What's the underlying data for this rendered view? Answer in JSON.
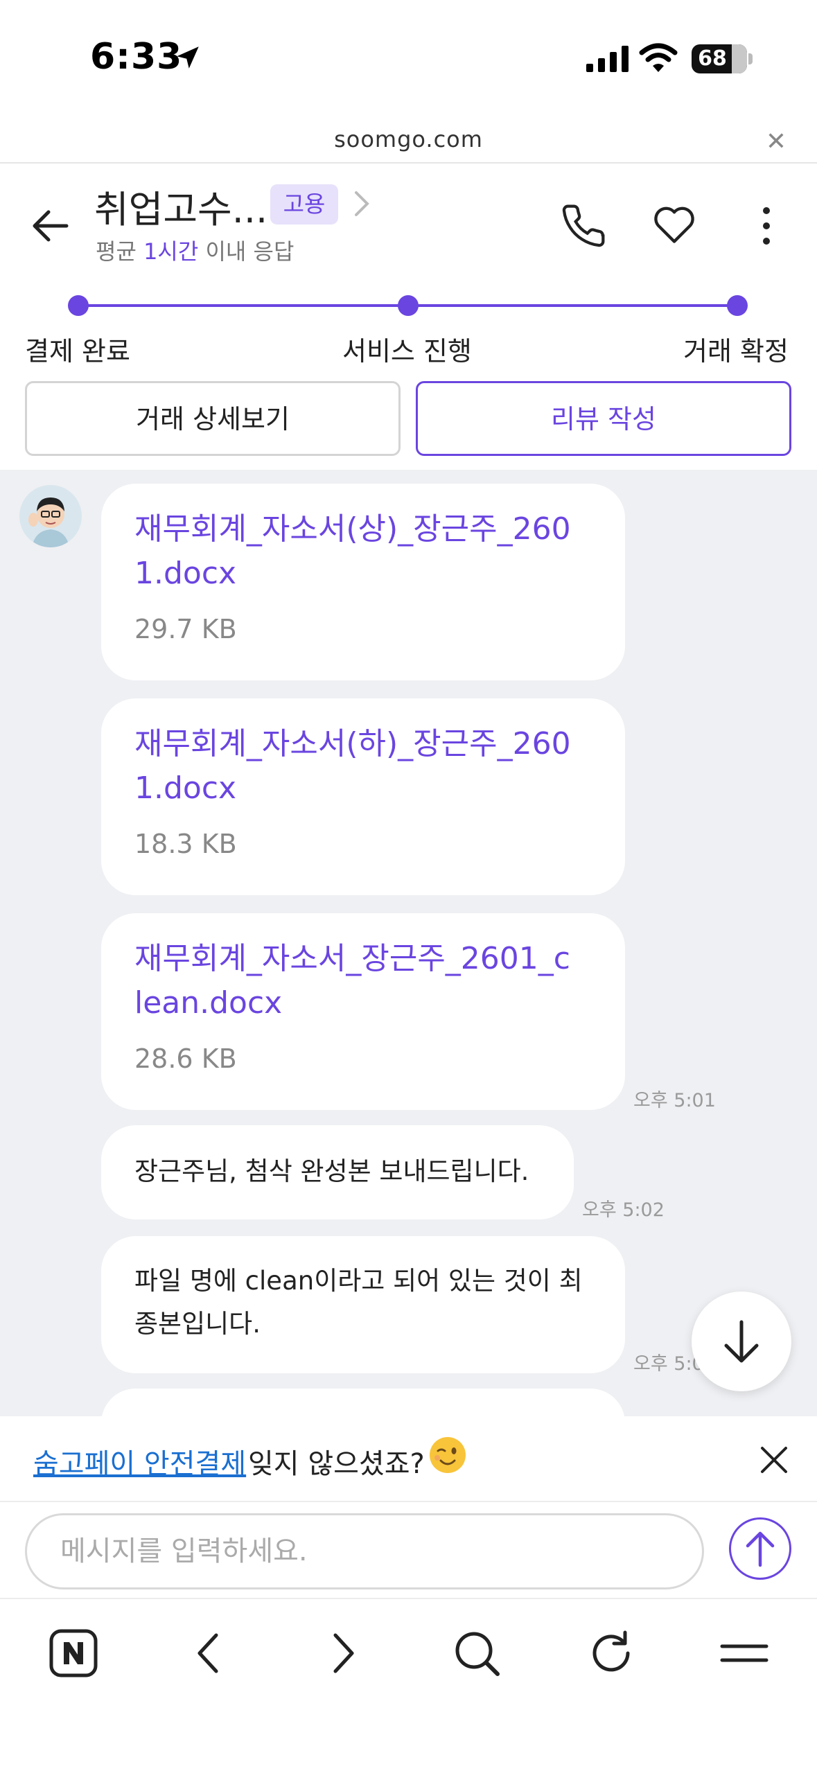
{
  "status_bar": {
    "time": "6:33",
    "battery": "68"
  },
  "browser": {
    "url": "soomgo.com"
  },
  "header": {
    "name": "취업고수...",
    "badge": "고용",
    "response_prefix": "평균 ",
    "response_highlight": "1시간",
    "response_suffix": " 이내 응답"
  },
  "progress_steps": [
    "결제 완료",
    "서비스 진행",
    "거래 확정"
  ],
  "buttons": {
    "detail": "거래 상세보기",
    "review": "리뷰 작성"
  },
  "messages": {
    "files": [
      {
        "name": "재무회계_자소서(상)_장근주_2601.docx",
        "size": "29.7 KB"
      },
      {
        "name": "재무회계_자소서(하)_장근주_2601.docx",
        "size": "18.3 KB"
      },
      {
        "name": "재무회계_자소서_장근주_2601_clean.docx",
        "size": "28.6 KB"
      }
    ],
    "file_time": "오후 5:01",
    "text_1": "장근주님, 첨삭 완성본 보내드립니다.",
    "text_1_time": "오후 5:02",
    "text_2": "파일 명에 clean이라고 되어 있는 것이 최종본입니다.",
    "text_2_time": "오후 5:0"
  },
  "notice": {
    "link": "숨고페이 안전결제",
    "text": "잊지 않으셨죠?"
  },
  "input": {
    "placeholder": "메시지를 입력하세요."
  },
  "colors": {
    "accent": "#6a45e0",
    "chat_bg": "#eff0f3",
    "link": "#1a6fd1"
  },
  "icons": [
    "location-arrow-icon",
    "signal-icon",
    "wifi-icon",
    "back-arrow-icon",
    "chevron-right-icon",
    "phone-icon",
    "heart-icon",
    "more-vertical-icon",
    "scroll-down-icon",
    "wink-emoji-icon",
    "close-icon",
    "send-icon",
    "naver-icon",
    "browser-back-icon",
    "browser-forward-icon",
    "search-icon",
    "refresh-icon",
    "menu-icon"
  ]
}
